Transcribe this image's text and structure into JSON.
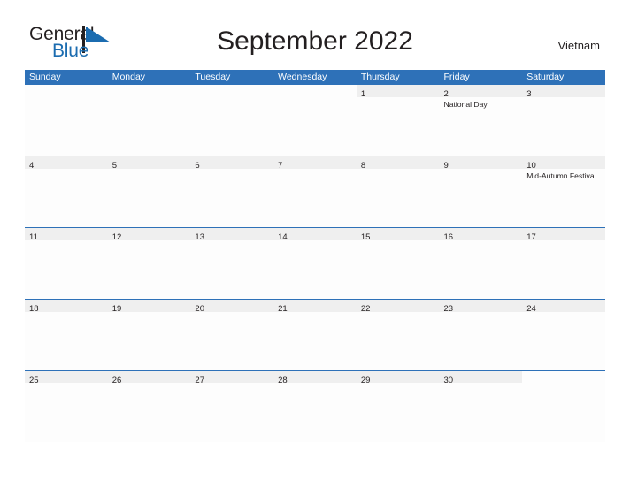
{
  "brand": {
    "name_part1": "General",
    "name_part2": "Blue",
    "flag_icon": "flag-icon",
    "accent_color": "#1b6cb0"
  },
  "header": {
    "title": "September 2022",
    "country": "Vietnam"
  },
  "colors": {
    "header_blue": "#2e71b8",
    "date_band_gray": "#efefef",
    "text": "#231f20"
  },
  "calendar": {
    "weekdays": [
      "Sunday",
      "Monday",
      "Tuesday",
      "Wednesday",
      "Thursday",
      "Friday",
      "Saturday"
    ],
    "weeks": [
      [
        {
          "day": "",
          "events": []
        },
        {
          "day": "",
          "events": []
        },
        {
          "day": "",
          "events": []
        },
        {
          "day": "",
          "events": []
        },
        {
          "day": "1",
          "events": []
        },
        {
          "day": "2",
          "events": [
            "National Day"
          ]
        },
        {
          "day": "3",
          "events": []
        }
      ],
      [
        {
          "day": "4",
          "events": []
        },
        {
          "day": "5",
          "events": []
        },
        {
          "day": "6",
          "events": []
        },
        {
          "day": "7",
          "events": []
        },
        {
          "day": "8",
          "events": []
        },
        {
          "day": "9",
          "events": []
        },
        {
          "day": "10",
          "events": [
            "Mid-Autumn Festival"
          ]
        }
      ],
      [
        {
          "day": "11",
          "events": []
        },
        {
          "day": "12",
          "events": []
        },
        {
          "day": "13",
          "events": []
        },
        {
          "day": "14",
          "events": []
        },
        {
          "day": "15",
          "events": []
        },
        {
          "day": "16",
          "events": []
        },
        {
          "day": "17",
          "events": []
        }
      ],
      [
        {
          "day": "18",
          "events": []
        },
        {
          "day": "19",
          "events": []
        },
        {
          "day": "20",
          "events": []
        },
        {
          "day": "21",
          "events": []
        },
        {
          "day": "22",
          "events": []
        },
        {
          "day": "23",
          "events": []
        },
        {
          "day": "24",
          "events": []
        }
      ],
      [
        {
          "day": "25",
          "events": []
        },
        {
          "day": "26",
          "events": []
        },
        {
          "day": "27",
          "events": []
        },
        {
          "day": "28",
          "events": []
        },
        {
          "day": "29",
          "events": []
        },
        {
          "day": "30",
          "events": []
        },
        {
          "day": "",
          "events": []
        }
      ]
    ]
  }
}
